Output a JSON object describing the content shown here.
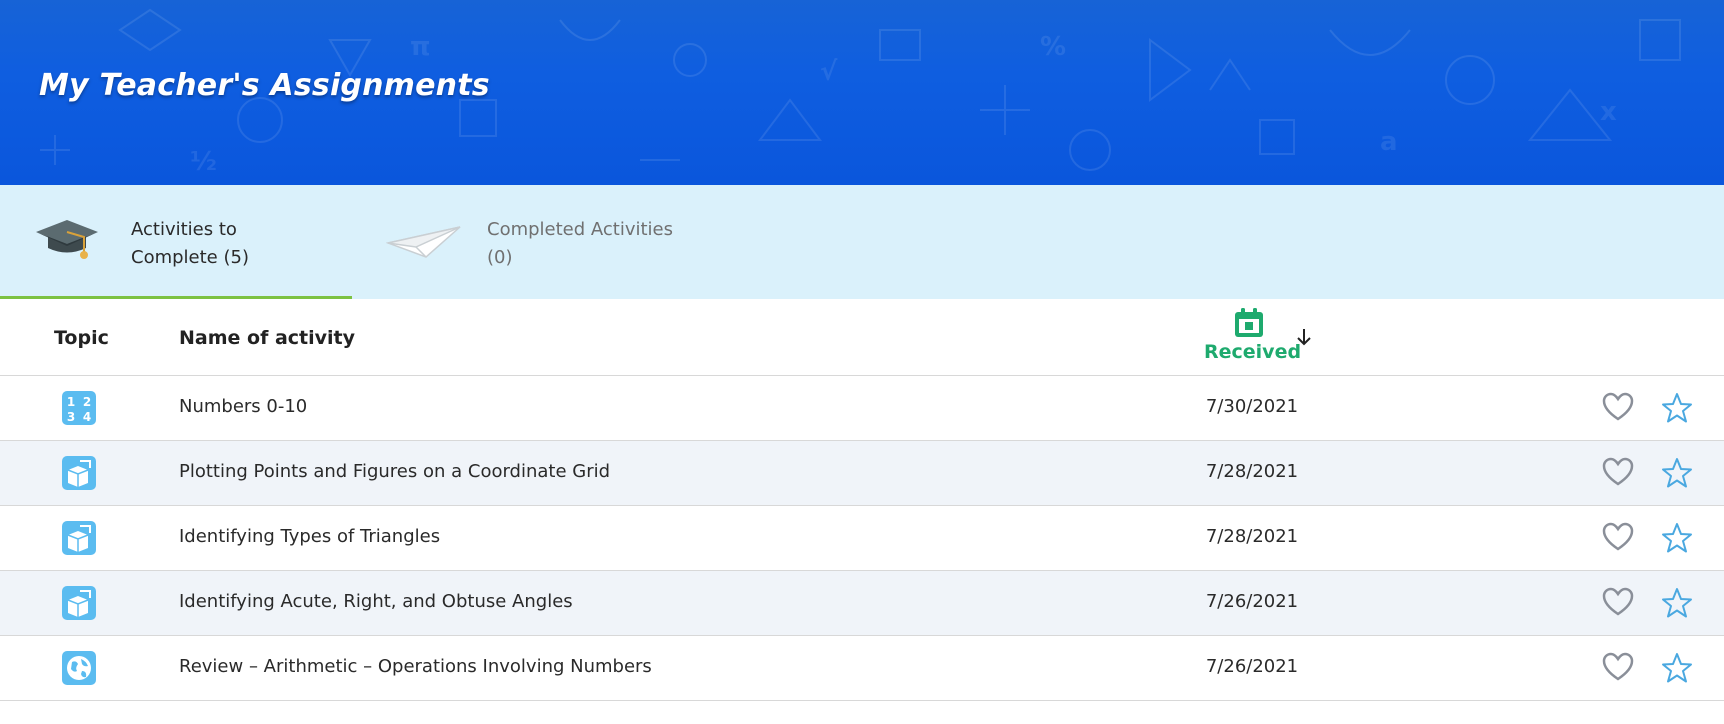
{
  "header": {
    "title": "My Teacher's Assignments",
    "background_color": "#0f5ee0"
  },
  "tabs": [
    {
      "label": "Activities to Complete (5)",
      "line1": "Activities to",
      "line2": "Complete (5)",
      "icon": "graduation-cap-icon",
      "active": true
    },
    {
      "label": "Completed Activities (0)",
      "line1": "Completed Activities",
      "line2": "(0)",
      "icon": "paper-plane-icon",
      "active": false
    }
  ],
  "table": {
    "headers": {
      "topic": "Topic",
      "name": "Name of activity",
      "received": "Received",
      "received_icon": "calendar-icon",
      "sort_icon": "arrow-down-icon"
    },
    "rows": [
      {
        "topic_icon": "numbers-icon",
        "name": "Numbers 0-10",
        "date": "7/30/2021"
      },
      {
        "topic_icon": "geometry-cube-icon",
        "name": "Plotting Points and Figures on a Coordinate Grid",
        "date": "7/28/2021"
      },
      {
        "topic_icon": "geometry-cube-icon",
        "name": "Identifying Types of Triangles",
        "date": "7/28/2021"
      },
      {
        "topic_icon": "geometry-cube-icon",
        "name": "Identifying Acute, Right, and Obtuse Angles",
        "date": "7/26/2021"
      },
      {
        "topic_icon": "globe-icon",
        "name": "Review – Arithmetic – Operations Involving Numbers",
        "date": "7/26/2021"
      }
    ]
  },
  "colors": {
    "accent_green": "#1eaa6e",
    "tab_underline": "#7cc242",
    "tabbar_bg": "#daf1fb",
    "topic_icon_blue": "#5bbcf0",
    "star_blue": "#4aa8e0",
    "heart_gray": "#8a8f99"
  }
}
